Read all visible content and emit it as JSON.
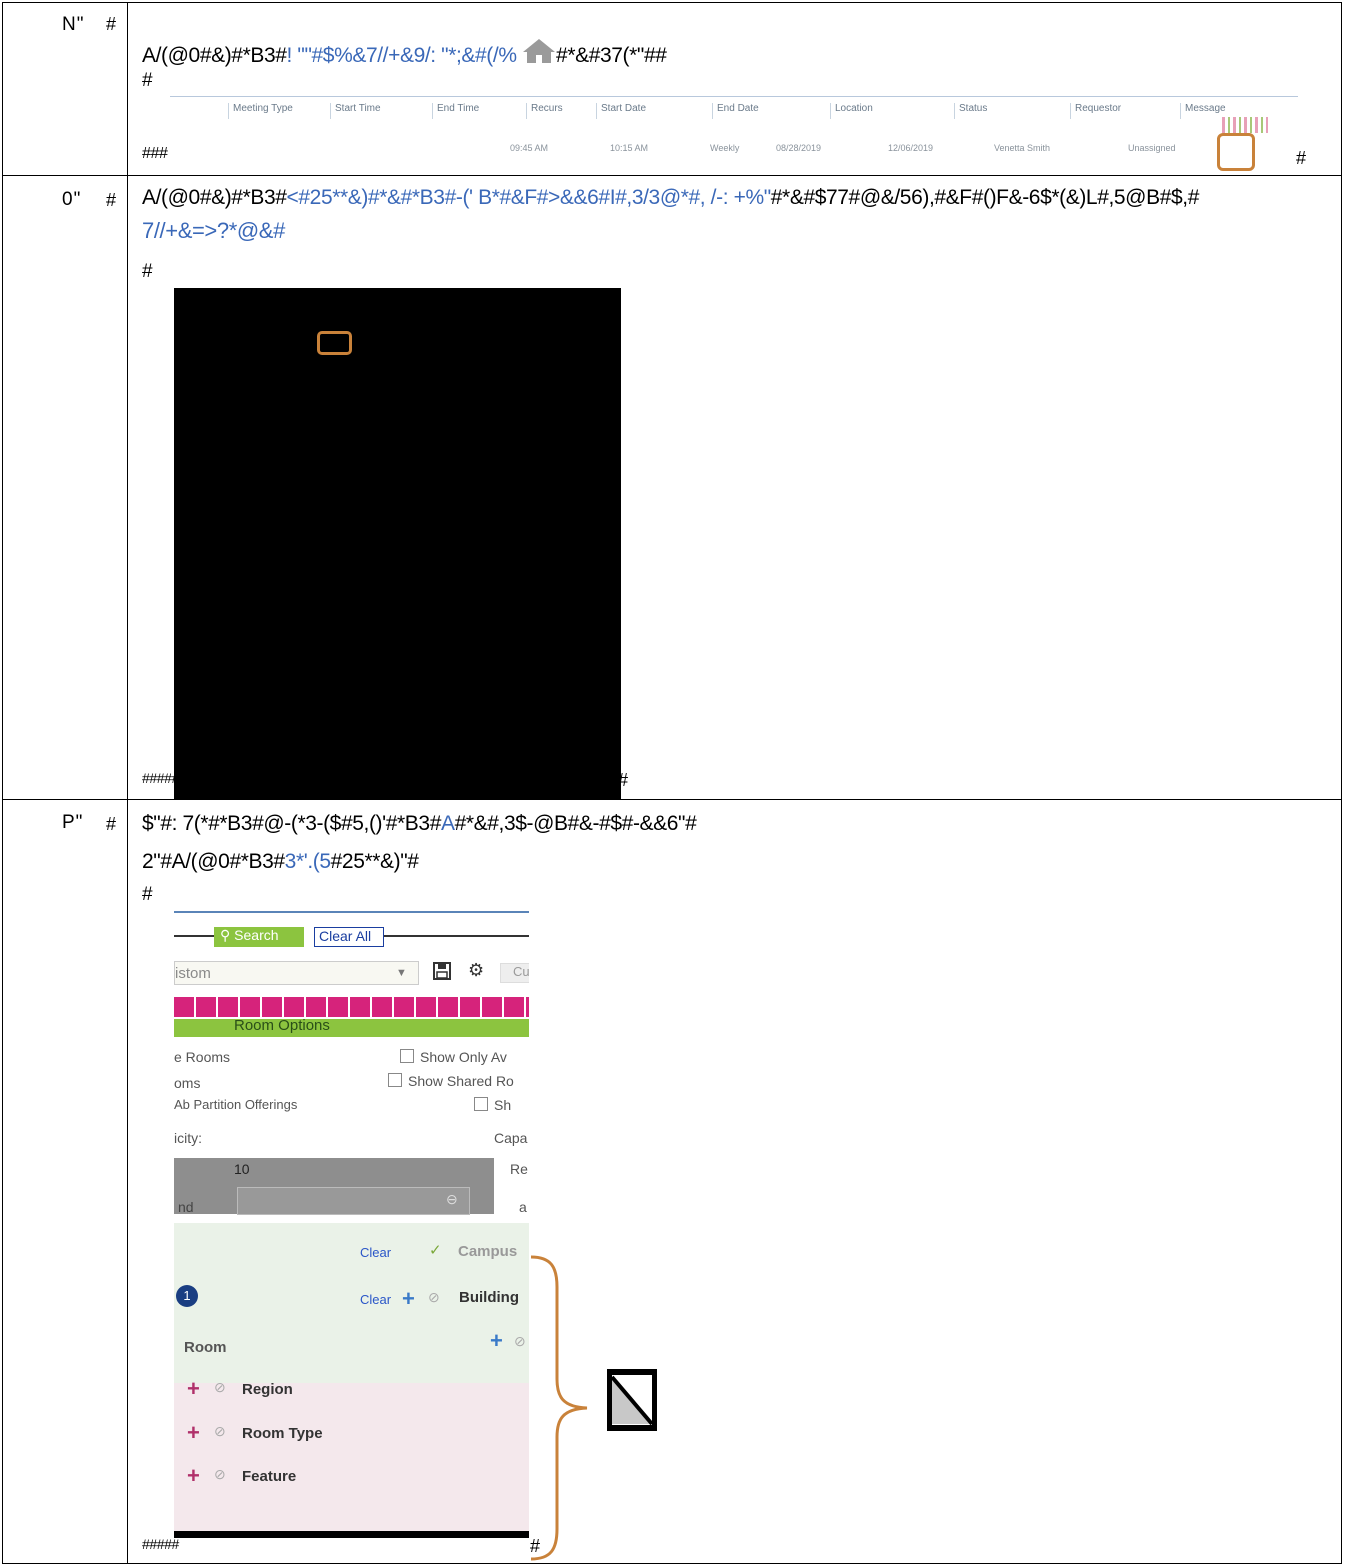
{
  "steps": [
    {
      "number": "N\"",
      "hash": "#",
      "line1": {
        "a": "A/(@0#&)#*B3#",
        "b": "! \"\"#$%&7//+&9/: \"*;&#(/%",
        "c": "#*&#37(*\"##"
      },
      "line2": "#",
      "line3": "###",
      "end_hash": "#",
      "table": {
        "headers": [
          "Meeting Type",
          "Start Time",
          "End Time",
          "Recurs",
          "Start Date",
          "End Date",
          "Location",
          "Status",
          "Requestor",
          "Message"
        ],
        "row": [
          "09:45 AM",
          "10:15 AM",
          "Weekly",
          "08/28/2019",
          "12/06/2019",
          "Venetta Smith",
          "Unassigned"
        ]
      }
    },
    {
      "number": "0\"",
      "hash": "#",
      "line1": {
        "a": "A/(@0#&)#*B3#",
        "b": "<#25**&)#*&#*B3#-(' B*#&F#>&&6#I#,3/3@*#,",
        "c": " /-: +%\"",
        "d": "#*&#$77#@&/56),#&F#()F&-6$*(&)L#,5@B#$,#"
      },
      "line2": "7//+&=>?*@&#",
      "line3": "#",
      "line4": "#####",
      "end_hash": "#"
    },
    {
      "number": "P\"",
      "hash": "#",
      "line1": {
        "a": "$\"#: 7(*#*B3#@-(*3-($#5,()'#*B3#",
        "b": "A",
        "c": "#*&#,3$-@B#&-#$#-&&6\"#"
      },
      "line2": {
        "a": "2\"#A/(@0#*B3#",
        "b": "3*'.(5",
        "c": "#25**&)\"#"
      },
      "line3": "#",
      "line4": "#####",
      "end_hash": "#"
    }
  ],
  "panel": {
    "search_label": "Search",
    "clear_all_label": "Clear All",
    "custom_select_value": "istom",
    "cu_label": "Cu",
    "room_options_label": "Room Options",
    "options": [
      {
        "label": "e Rooms",
        "checkbox_label": "Show Only Av"
      },
      {
        "label": "oms",
        "checkbox_label": "Show Shared Ro"
      },
      {
        "label": "Ab Partition Offerings",
        "checkbox_label": "Sh"
      }
    ],
    "capacity_label": "icity:",
    "capacity_right_label": "Capa",
    "capacity_value": "10",
    "re_label": "Re",
    "nd_label": "nd",
    "a_label": "a",
    "filters": [
      {
        "name": "Campus",
        "clear": "Clear",
        "icon": "check-icon"
      },
      {
        "name": "Building",
        "clear": "Clear",
        "icon": "plus-icon"
      },
      {
        "name": "Room",
        "clear": "",
        "icon": "plus-icon"
      },
      {
        "name": "Region",
        "icon": "plus-icon"
      },
      {
        "name": "Room Type",
        "icon": "plus-icon"
      },
      {
        "name": "Feature",
        "icon": "plus-icon"
      }
    ],
    "badge_count": "1"
  },
  "colors": {
    "link_blue": "#3a68b8",
    "highlight_orange": "#c9823a",
    "green": "#8cc43f",
    "magenta": "#d6237b",
    "navy": "#1a3e82"
  }
}
